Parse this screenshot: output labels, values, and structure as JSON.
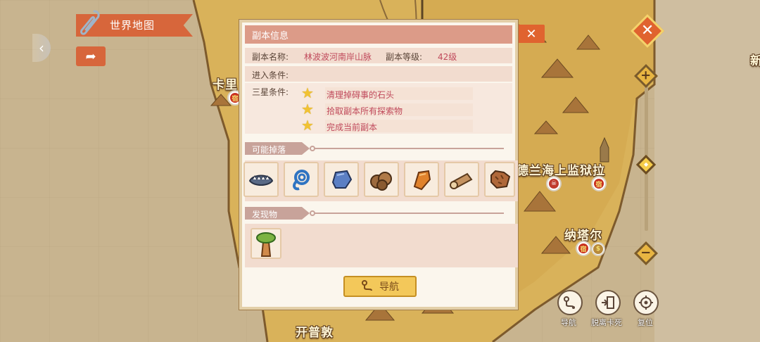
{
  "top_left": {
    "world_map_label": "世界地图",
    "back_icon": "chevron-left-icon",
    "share_icon": "share-arrow-icon"
  },
  "map_labels": {
    "kali": "卡里",
    "prison": "尼德兰海上监狱拉",
    "nata": "纳塔尔",
    "kaipudun": "开普敦",
    "edge": "新"
  },
  "dialog": {
    "title": "副本信息",
    "name_label": "副本名称:",
    "name_value": "林波波河南岸山脉",
    "level_label": "副本等级:",
    "level_value": "42级",
    "entry_label": "进入条件:",
    "star_label": "三星条件:",
    "star_conditions": [
      "清理掉碍事的石头",
      "拾取副本所有探索物",
      "完成当前副本"
    ],
    "drops_section": "可能掉落",
    "drops": [
      "bone-jaw-icon",
      "rope-coil-icon",
      "ore-stone-icon",
      "clay-lumps-icon",
      "amber-shard-icon",
      "wood-log-icon",
      "fur-pelt-icon"
    ],
    "find_section": "发现物",
    "finds": [
      "baobab-tree-icon"
    ],
    "nav_button": "导航",
    "close_icon": "close-icon"
  },
  "bottom_tools": {
    "navigate": "导航",
    "escape": "脱离卡死",
    "reset": "复位"
  },
  "colors": {
    "accent_orange": "#e0632f",
    "dialog_header": "#dc9b88",
    "value_red": "#c0495b",
    "button_gold": "#f3c85a"
  }
}
